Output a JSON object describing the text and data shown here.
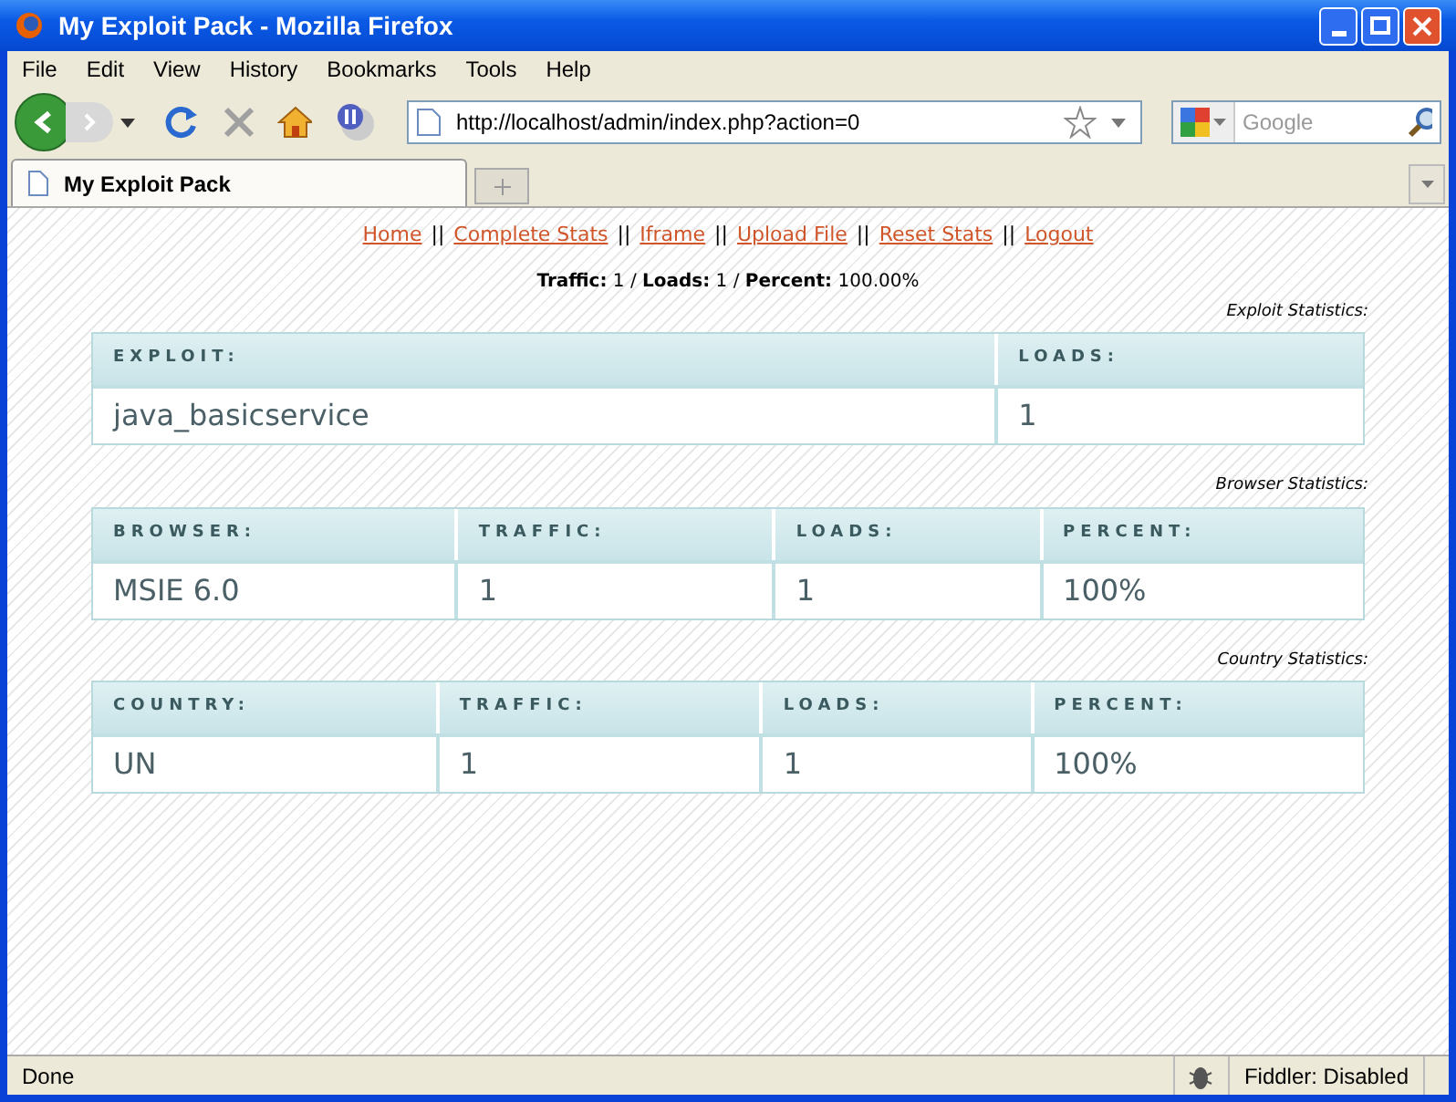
{
  "window": {
    "title": "My Exploit Pack - Mozilla Firefox"
  },
  "menu": [
    "File",
    "Edit",
    "View",
    "History",
    "Bookmarks",
    "Tools",
    "Help"
  ],
  "address_bar": {
    "value": "http://localhost/admin/index.php?action=0"
  },
  "search": {
    "placeholder": "Google"
  },
  "tabs": [
    {
      "label": "My Exploit Pack",
      "selected": true
    }
  ],
  "nav_links": [
    "Home",
    "Complete Stats",
    "Iframe",
    "Upload File",
    "Reset Stats",
    "Logout"
  ],
  "separator": "||",
  "summary": "**Traffic:** 1 / **Loads:** 1 / **Percent:** 100.00%",
  "tables": [
    {
      "caption": "Exploit Statistics:",
      "columns": [
        "EXPLOIT:",
        "LOADS:"
      ],
      "rows": [
        [
          "java_basicservice",
          "1"
        ]
      ]
    },
    {
      "caption": "Browser Statistics:",
      "columns": [
        "BROWSER:",
        "TRAFFIC:",
        "LOADS:",
        "PERCENT:"
      ],
      "rows": [
        [
          "MSIE 6.0",
          "1",
          "1",
          "100%"
        ]
      ]
    },
    {
      "caption": "Country Statistics:",
      "columns": [
        "COUNTRY:",
        "TRAFFIC:",
        "LOADS:",
        "PERCENT:"
      ],
      "rows": [
        [
          "UN",
          "1",
          "1",
          "100%"
        ]
      ]
    }
  ],
  "status_bar": {
    "text": "Done",
    "addon": "Fiddler: Disabled"
  }
}
